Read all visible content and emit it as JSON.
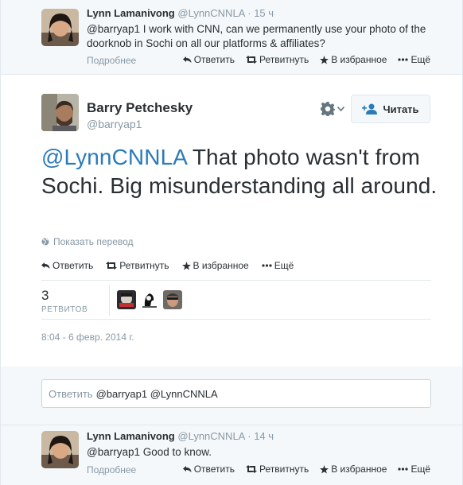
{
  "context_top": {
    "fullname": "Lynn Lamanivong",
    "handle": "@LynnCNNLA",
    "time": "· 15 ч",
    "text": "@barryap1 I work with CNN, can we permanently use your photo of the doorknob in Sochi on all our platforms & affiliates?",
    "label": "Подробнее",
    "actions": {
      "reply": "Ответить",
      "retweet": "Ретвитнуть",
      "favorite": "В избранное",
      "more": "Ещё"
    }
  },
  "main": {
    "fullname": "Barry Petchesky",
    "handle": "@barryap1",
    "follow_label": "Читать",
    "mention": "@LynnCNNLA",
    "text": " That photo wasn't from Sochi. Big misunderstanding all around.",
    "translate": "Показать перевод",
    "actions": {
      "reply": "Ответить",
      "retweet": "Ретвитнуть",
      "favorite": "В избранное",
      "more": "Ещё"
    },
    "retweet_count": "3",
    "retweet_label": "РЕТВИТОВ",
    "date": "8:04 - 6 февр. 2014 г."
  },
  "reply_box": {
    "placeholder": "Ответить",
    "value": "@barryap1 @LynnCNNLA"
  },
  "context_bottom": {
    "fullname": "Lynn Lamanivong",
    "handle": "@LynnCNNLA",
    "time": "· 14 ч",
    "text": "@barryap1 Good to know.",
    "label": "Подробнее",
    "actions": {
      "reply": "Ответить",
      "retweet": "Ретвитнуть",
      "favorite": "В избранное",
      "more": "Ещё"
    }
  },
  "colors": {
    "link": "#2b7bb9",
    "muted": "#8899a6",
    "text": "#292f33",
    "border": "#e1e8ed",
    "bg_context": "#f5f8fa"
  },
  "icons": [
    "reply-icon",
    "retweet-icon",
    "star-icon",
    "more-icon",
    "gear-icon",
    "add-user-icon",
    "globe-icon"
  ]
}
